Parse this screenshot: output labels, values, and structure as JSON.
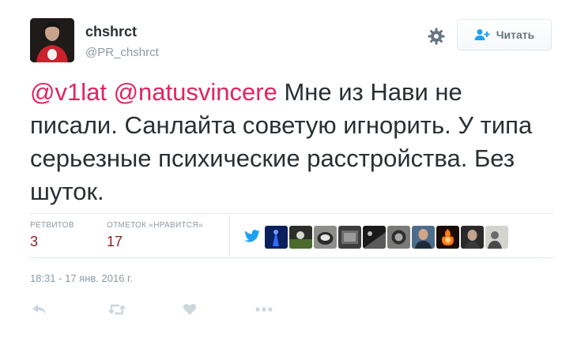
{
  "user": {
    "name": "chshrct",
    "handle": "@PR_chshrct"
  },
  "follow_button": {
    "label": "Читать"
  },
  "tweet": {
    "mention1": "@v1lat",
    "mention2": "@natusvincere",
    "body": " Мне из Нави не писали. Санлайта советую игнорить. У типа серьезные психические расстройства. Без шуток."
  },
  "stats": {
    "retweets_label": "РЕТВИТОВ",
    "retweets_value": "3",
    "likes_label": "ОТМЕТОК «НРАВИТСЯ»",
    "likes_value": "17"
  },
  "timestamp": "18:31 - 17 янв. 2016 г.",
  "icons": {
    "settings": "gear-icon",
    "follow": "add-user-icon",
    "reply": "reply-icon",
    "retweet": "retweet-icon",
    "like": "heart-icon",
    "more": "more-icon"
  },
  "colors": {
    "mention": "#e0245e",
    "stat_value": "#8b2323",
    "muted": "#8899a6",
    "text": "#292f33"
  }
}
